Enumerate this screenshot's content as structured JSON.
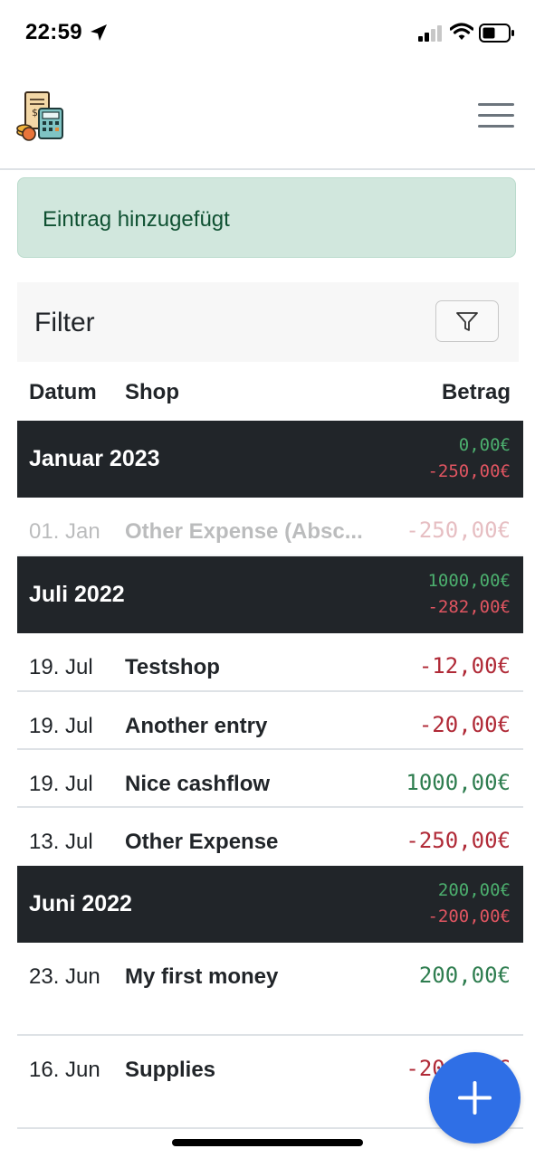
{
  "status_bar": {
    "time": "22:59",
    "icons": [
      "location-arrow-icon",
      "signal-icon",
      "wifi-icon",
      "battery-icon"
    ]
  },
  "navbar": {
    "logo_icon": "calculator-coins-icon",
    "menu_icon": "hamburger-menu-icon"
  },
  "alert": {
    "text": "Eintrag hinzugefügt"
  },
  "filter": {
    "title": "Filter",
    "button_icon": "funnel-icon"
  },
  "table": {
    "headers": {
      "date": "Datum",
      "shop": "Shop",
      "amount": "Betrag"
    },
    "groups": [
      {
        "title": "Januar 2023",
        "income": "0,00€",
        "expense": "-250,00€"
      },
      {
        "title": "Juli 2022",
        "income": "1000,00€",
        "expense": "-282,00€"
      },
      {
        "title": "Juni 2022",
        "income": "200,00€",
        "expense": "-200,00€"
      }
    ],
    "rows": [
      {
        "date": "01. Jan",
        "shop": "Other Expense (Absc...",
        "amount": "-250,00€"
      },
      {
        "date": "19. Jul",
        "shop": "Testshop",
        "amount": "-12,00€"
      },
      {
        "date": "19. Jul",
        "shop": "Another entry",
        "amount": "-20,00€"
      },
      {
        "date": "19. Jul",
        "shop": "Nice cashflow",
        "amount": "1000,00€"
      },
      {
        "date": "13. Jul",
        "shop": "Other Expense",
        "amount": "-250,00€"
      },
      {
        "date": "23. Jun",
        "shop": "My first money",
        "amount": "200,00€"
      },
      {
        "date": "16. Jun",
        "shop": "Supplies",
        "amount": "-200,00€"
      }
    ]
  },
  "fab": {
    "icon": "plus-icon"
  },
  "colors": {
    "alert_bg": "#d1e7dd",
    "group_bg": "#212529",
    "negative": "#b02a37",
    "positive": "#2e7d4f",
    "fab": "#2f6fe6"
  }
}
